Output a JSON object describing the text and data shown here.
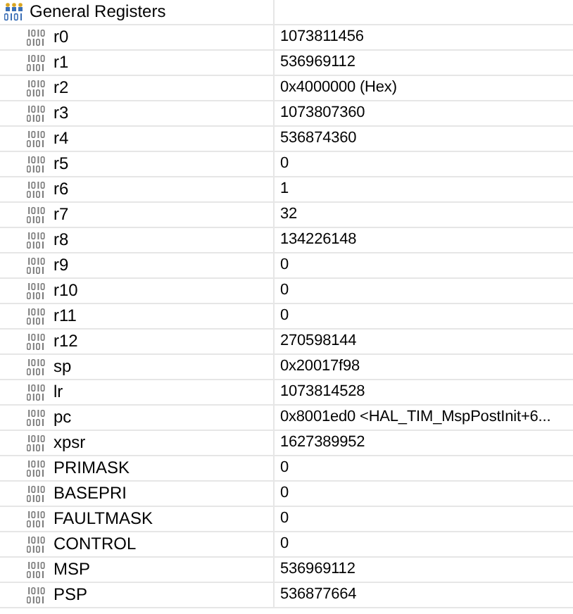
{
  "group": {
    "name": "General Registers"
  },
  "registers": [
    {
      "name": "r0",
      "value": "1073811456"
    },
    {
      "name": "r1",
      "value": "536969112"
    },
    {
      "name": "r2",
      "value": "0x4000000 (Hex)"
    },
    {
      "name": "r3",
      "value": "1073807360"
    },
    {
      "name": "r4",
      "value": "536874360"
    },
    {
      "name": "r5",
      "value": "0"
    },
    {
      "name": "r6",
      "value": "1"
    },
    {
      "name": "r7",
      "value": "32"
    },
    {
      "name": "r8",
      "value": "134226148"
    },
    {
      "name": "r9",
      "value": "0"
    },
    {
      "name": "r10",
      "value": "0"
    },
    {
      "name": "r11",
      "value": "0"
    },
    {
      "name": "r12",
      "value": "270598144"
    },
    {
      "name": "sp",
      "value": "0x20017f98"
    },
    {
      "name": "lr",
      "value": "1073814528"
    },
    {
      "name": "pc",
      "value": "0x8001ed0 <HAL_TIM_MspPostInit+6..."
    },
    {
      "name": "xpsr",
      "value": "1627389952"
    },
    {
      "name": "PRIMASK",
      "value": "0"
    },
    {
      "name": "BASEPRI",
      "value": "0"
    },
    {
      "name": "FAULTMASK",
      "value": "0"
    },
    {
      "name": "CONTROL",
      "value": "0"
    },
    {
      "name": "MSP",
      "value": "536969112"
    },
    {
      "name": "PSP",
      "value": "536877664"
    }
  ]
}
